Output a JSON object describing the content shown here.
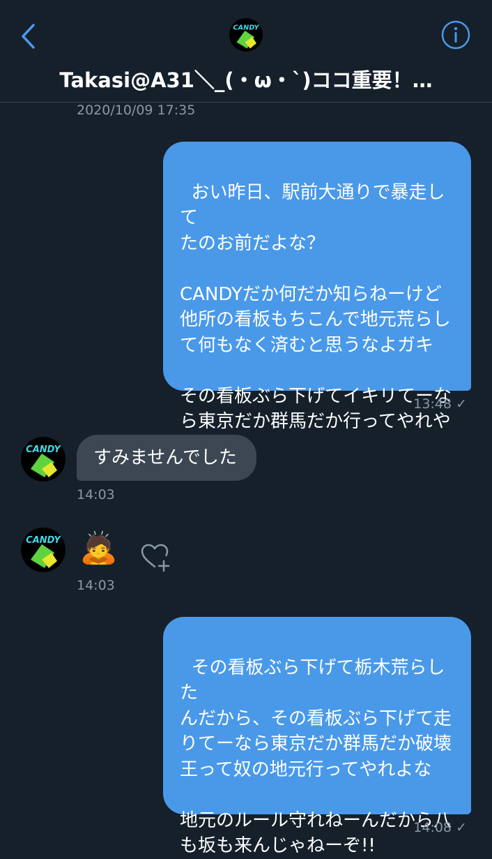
{
  "header": {
    "title": "Takasi@A31＼_(・ω・`)ココ重要！…",
    "avatar_text": "CANDY"
  },
  "thread": {
    "date_stamp": "2020/10/09 17:35"
  },
  "messages": [
    {
      "text": "おい昨日、駅前大通りで暴走して\nたのお前だよな？\n\nCANDYだか何だか知らねーけど\n他所の看板もちこんで地元荒らし\nて何もなく済むと思うなよガキ\n\nその看板ぶら下げてイキリてーな\nら東京だか群馬だか行ってやれや",
      "time": "13:48",
      "check": "✓"
    },
    {
      "text": "すみませんでした",
      "time": "14:03"
    },
    {
      "emoji": "🙇",
      "time": "14:03"
    },
    {
      "text": "その看板ぶら下げて栃木荒らした\nんだから、その看板ぶら下げて走\nりてーなら東京だか群馬だか破壊\n王って奴の地元行ってやれよな\n\n地元のルール守れねーんだから八\nも坂も来んじゃねーぞ!!",
      "time": "14:08",
      "check": "✓"
    }
  ],
  "colors": {
    "background": "#15202b",
    "sent_bubble": "#4a99e9",
    "received_bubble": "#3d4753",
    "accent": "#4a99e9",
    "muted": "#8899a6"
  },
  "icons": {
    "back": "chevron-left-icon",
    "info": "info-circle-icon",
    "heart_add": "heart-plus-icon"
  }
}
